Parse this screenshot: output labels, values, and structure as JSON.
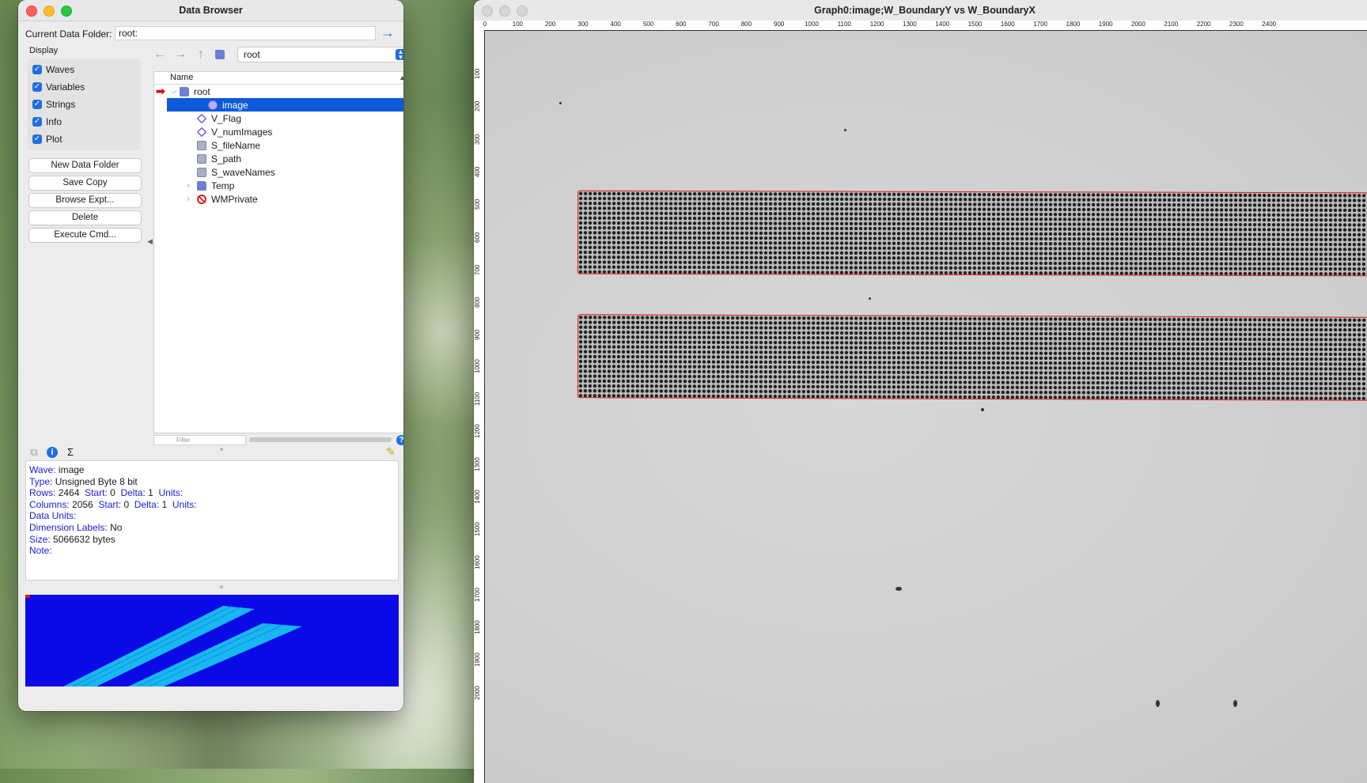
{
  "data_browser": {
    "title": "Data Browser",
    "current_folder_label": "Current Data Folder:",
    "current_folder_value": "root:",
    "display_label": "Display",
    "display_options": [
      {
        "label": "Waves",
        "checked": true
      },
      {
        "label": "Variables",
        "checked": true
      },
      {
        "label": "Strings",
        "checked": true
      },
      {
        "label": "Info",
        "checked": true
      },
      {
        "label": "Plot",
        "checked": true
      }
    ],
    "buttons": [
      "New Data Folder",
      "Save Copy",
      "Browse Expt...",
      "Delete",
      "Execute Cmd..."
    ],
    "folder_select": "root",
    "tree_header": "Name",
    "tree": [
      {
        "label": "root",
        "type": "folder",
        "expanded": true
      },
      {
        "label": "image",
        "type": "wave",
        "selected": true
      },
      {
        "label": "V_Flag",
        "type": "variable"
      },
      {
        "label": "V_numImages",
        "type": "variable"
      },
      {
        "label": "S_fileName",
        "type": "string"
      },
      {
        "label": "S_path",
        "type": "string"
      },
      {
        "label": "S_waveNames",
        "type": "string"
      },
      {
        "label": "Temp",
        "type": "folder",
        "expanded": false
      },
      {
        "label": "WMPrivate",
        "type": "no-access",
        "expanded": false
      }
    ],
    "filter_placeholder": "Filter",
    "info": {
      "wave_k": "Wave:",
      "wave_v": "image",
      "type_k": "Type:",
      "type_v": "Unsigned Byte 8 bit",
      "rows_k": "Rows:",
      "rows_v": "2464",
      "start_k": "Start:",
      "start_v": "0",
      "delta_k": "Delta:",
      "delta_v": "1",
      "units_k": "Units:",
      "cols_k": "Columns:",
      "cols_v": "2056",
      "dataunits_k": "Data Units:",
      "dimlabels_k": "Dimension Labels:",
      "dimlabels_v": "No",
      "size_k": "Size:",
      "size_v": "5066632 bytes",
      "note_k": "Note:"
    }
  },
  "graph": {
    "title": "Graph0:image;W_BoundaryY vs W_BoundaryX",
    "x_ticks": [
      "0",
      "100",
      "200",
      "300",
      "400",
      "500",
      "600",
      "700",
      "800",
      "900",
      "1000",
      "1100",
      "1200",
      "1300",
      "1400",
      "1500",
      "1600",
      "1700",
      "1800",
      "1900",
      "2000",
      "2100",
      "2200",
      "2300",
      "2400"
    ],
    "y_ticks": [
      "100",
      "200",
      "300",
      "400",
      "500",
      "600",
      "700",
      "800",
      "900",
      "1000",
      "1100",
      "1200",
      "1300",
      "1400",
      "1500",
      "1600",
      "1700",
      "1800",
      "1900",
      "2000"
    ],
    "boundary_color": "#e01818"
  }
}
